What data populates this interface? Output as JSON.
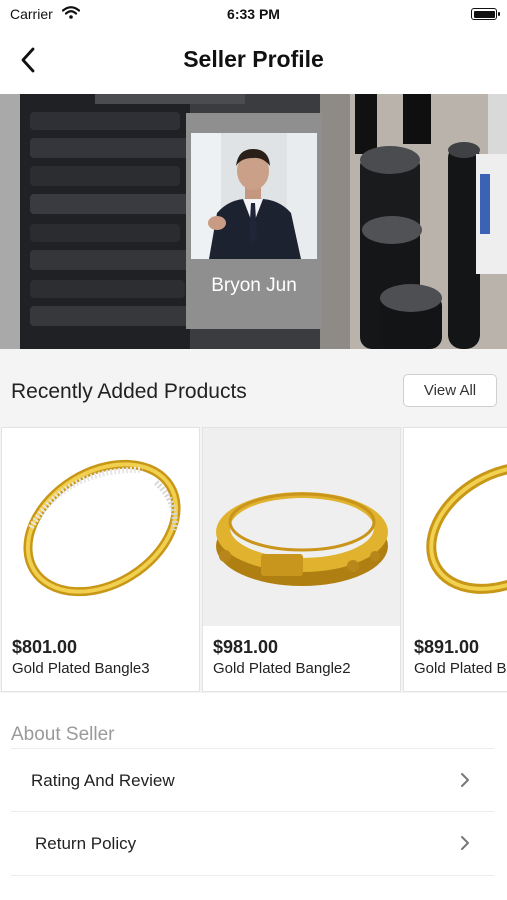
{
  "status_bar": {
    "carrier": "Carrier",
    "time": "6:33 PM"
  },
  "nav": {
    "title": "Seller Profile"
  },
  "seller": {
    "name": "Bryon Jun"
  },
  "recent": {
    "title": "Recently Added Products",
    "view_all": "View All",
    "products": [
      {
        "price": "$801.00",
        "name": "Gold Plated Bangle3"
      },
      {
        "price": "$981.00",
        "name": "Gold Plated Bangle2"
      },
      {
        "price": "$891.00",
        "name": "Gold Plated B"
      }
    ]
  },
  "about": {
    "title": "About Seller",
    "items": [
      {
        "label": "Rating And Review"
      },
      {
        "label": "Return Policy"
      }
    ]
  },
  "colors": {
    "gold": "#d9a91e",
    "card_gray": "#8f8f8f",
    "muted_text": "#9a9a9a"
  }
}
